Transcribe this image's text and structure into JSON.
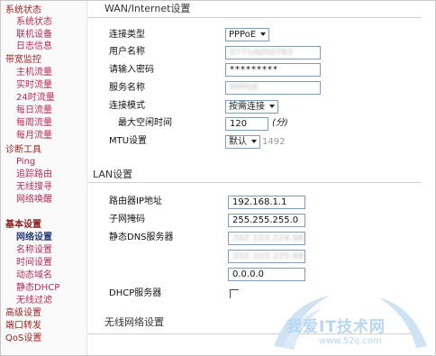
{
  "sidebar": {
    "items": [
      {
        "label": "系统状态",
        "level": 0
      },
      {
        "label": "系统状态",
        "level": 1
      },
      {
        "label": "联机设备",
        "level": 1
      },
      {
        "label": "日志信息",
        "level": 1
      },
      {
        "label": "带宽监控",
        "level": 0
      },
      {
        "label": "主机流量",
        "level": 1
      },
      {
        "label": "实时流量",
        "level": 1
      },
      {
        "label": "24时流量",
        "level": 1
      },
      {
        "label": "每日流量",
        "level": 1
      },
      {
        "label": "每周流量",
        "level": 1
      },
      {
        "label": "每月流量",
        "level": 1
      },
      {
        "label": "诊断工具",
        "level": 0
      },
      {
        "label": "Ping",
        "level": 1
      },
      {
        "label": "追踪路由",
        "level": 1
      },
      {
        "label": "无线搜寻",
        "level": 1
      },
      {
        "label": "网络唤醒",
        "level": 1
      },
      {
        "label": "基本设置",
        "level": 0
      },
      {
        "label": "网络设置",
        "level": 1
      },
      {
        "label": "名称设置",
        "level": 1
      },
      {
        "label": "时间设置",
        "level": 1
      },
      {
        "label": "动态域名",
        "level": 1
      },
      {
        "label": "静态DHCP",
        "level": 1
      },
      {
        "label": "无线过滤",
        "level": 1
      },
      {
        "label": "高级设置",
        "level": 0
      },
      {
        "label": "端口转发",
        "level": 0
      },
      {
        "label": "QoS设置",
        "level": 0
      }
    ]
  },
  "wan": {
    "title": "WAN/Internet设置",
    "connection_type_label": "连接类型",
    "connection_type_value": "PPPoE",
    "username_label": "用户名称",
    "username_value": "07716050783",
    "password_label": "请输入密码",
    "password_value": "*********",
    "service_name_label": "服务名称",
    "service_name_value": "PPPOE",
    "connect_mode_label": "连接模式",
    "connect_mode_value": "按需连接",
    "max_idle_label": "最大空闲时间",
    "max_idle_value": "120",
    "max_idle_unit": "(分)",
    "mtu_label": "MTU设置",
    "mtu_mode_value": "默认",
    "mtu_value": "1492"
  },
  "lan": {
    "title": "LAN设置",
    "router_ip_label": "路由器IP地址",
    "router_ip_value": "192.168.1.1",
    "subnet_label": "子网掩码",
    "subnet_value": "255.255.255.0",
    "dns_label": "静态DNS服务器",
    "dns1_value": "202.103.224.68",
    "dns2_value": "202.103.225.68",
    "dns3_value": "0.0.0.0",
    "dhcp_label": "DHCP服务器"
  },
  "wireless": {
    "title": "无线网络设置"
  },
  "watermark": {
    "text": "我爱IT技术网",
    "url": "www.52ij.com"
  },
  "colors": {
    "sidebar_header": "#9b2222",
    "sidebar_sub": "#b22a5a",
    "sidebar_active": "#2a3a7a",
    "input_border": "#7f9db9",
    "watermark": "#b8d6ee"
  }
}
